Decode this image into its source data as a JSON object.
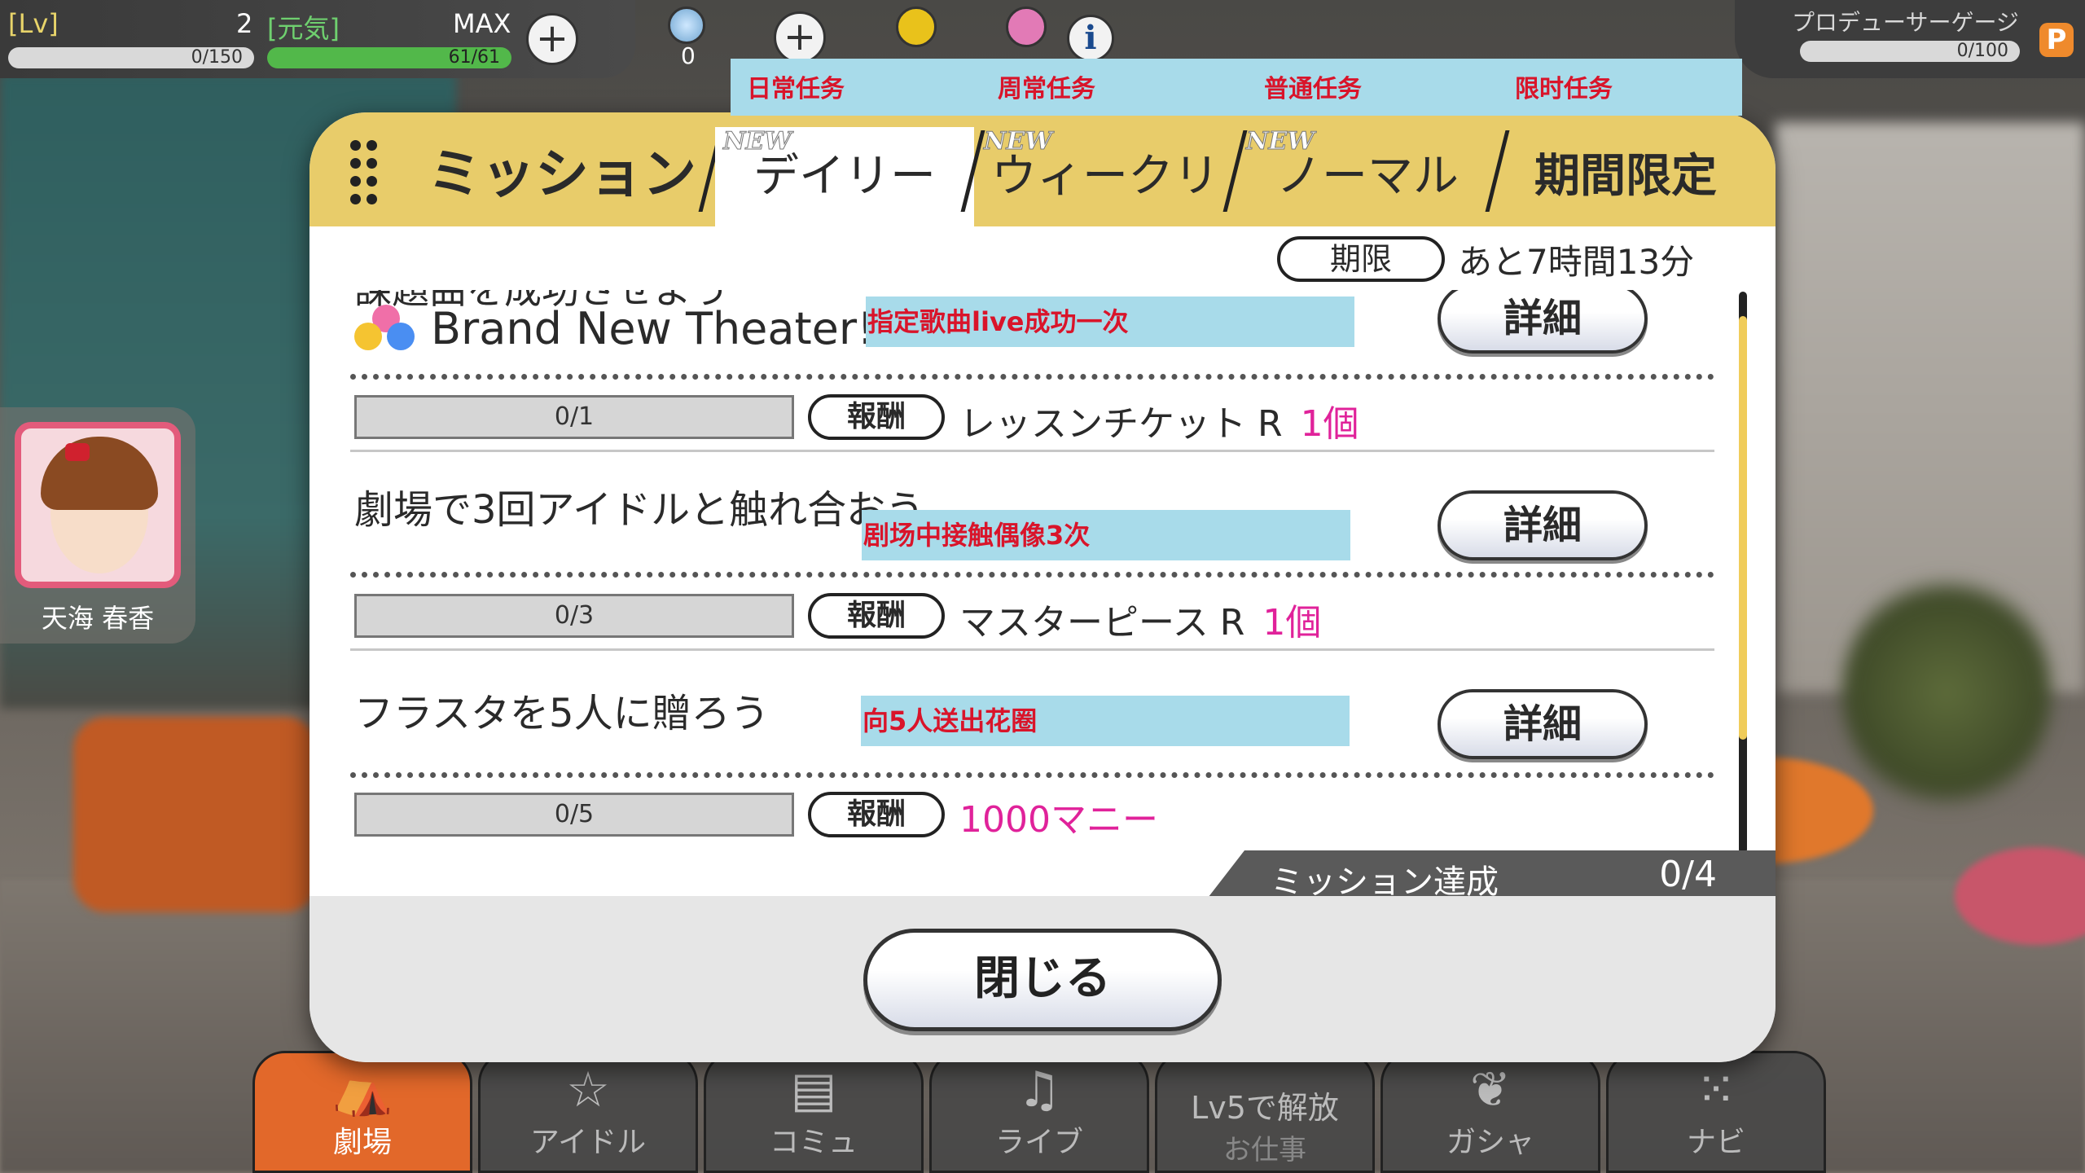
{
  "status_bar": {
    "lv_label": "[Lv]",
    "lv_value": "2",
    "genki_label": "[元気]",
    "max_label": "MAX",
    "exp_text": "0/150",
    "exp_progress": 0,
    "genki_text": "61/61",
    "genki_progress": 1.0,
    "gem_count": "0"
  },
  "producer_gauge": {
    "label": "プロデューサーゲージ",
    "value": "0/100",
    "progress": 0,
    "badge": "P"
  },
  "idol_card": {
    "name": "天海 春香"
  },
  "translation_tabs": [
    "日常任务",
    "周常任务",
    "普通任务",
    "限时任务"
  ],
  "dialog": {
    "title": "ミッション",
    "tabs": [
      {
        "label": "デイリー",
        "new_badge": "NEW",
        "active": true
      },
      {
        "label": "ウィークリー",
        "new_badge": "NEW",
        "active": false
      },
      {
        "label": "ノーマル",
        "new_badge": "NEW",
        "active": false
      },
      {
        "label": "期間限定",
        "new_badge": "",
        "active": false
      }
    ],
    "deadline_label": "期限",
    "deadline_text": "あと7時間13分",
    "missions": [
      {
        "title": "課題曲を成功させよう",
        "song": "Brand New Theater!",
        "note": "指定歌曲live成功一次",
        "detail_label": "詳細",
        "progress_text": "0/1",
        "progress": 0,
        "reward_label": "報酬",
        "reward_item": "レッスンチケット R",
        "reward_count": "1個"
      },
      {
        "title": "劇場で3回アイドルと触れ合おう",
        "note": "剧场中接触偶像3次",
        "detail_label": "詳細",
        "progress_text": "0/3",
        "progress": 0,
        "reward_label": "報酬",
        "reward_item": "マスターピース R",
        "reward_count": "1個"
      },
      {
        "title": "フラスタを5人に贈ろう",
        "note": "向5人送出花圈",
        "detail_label": "詳細",
        "progress_text": "0/5",
        "progress": 0,
        "reward_label": "報酬",
        "reward_item": "1000マニー",
        "reward_count": ""
      }
    ],
    "achievement_label": "ミッション達成",
    "achievement_count": "0/4",
    "close_label": "閉じる"
  },
  "bottom_nav": [
    {
      "label": "劇場",
      "icon": "theater-icon",
      "active": true
    },
    {
      "label": "アイドル",
      "icon": "idol-icon",
      "active": false
    },
    {
      "label": "コミュ",
      "icon": "commu-icon",
      "active": false
    },
    {
      "label": "ライブ",
      "icon": "live-icon",
      "active": false
    },
    {
      "label": "Lv5で解放",
      "sublabel": "お仕事",
      "icon": "work-icon",
      "active": false
    },
    {
      "label": "ガシャ",
      "icon": "gacha-icon",
      "active": false
    },
    {
      "label": "ナビ",
      "icon": "navi-icon",
      "active": false
    }
  ],
  "colors": {
    "header_gold": "#e8cc6a",
    "reward_pink": "#e0229a",
    "note_blue": "#a8dbea",
    "note_red": "#d9142a",
    "nav_active": "#e2682a"
  }
}
